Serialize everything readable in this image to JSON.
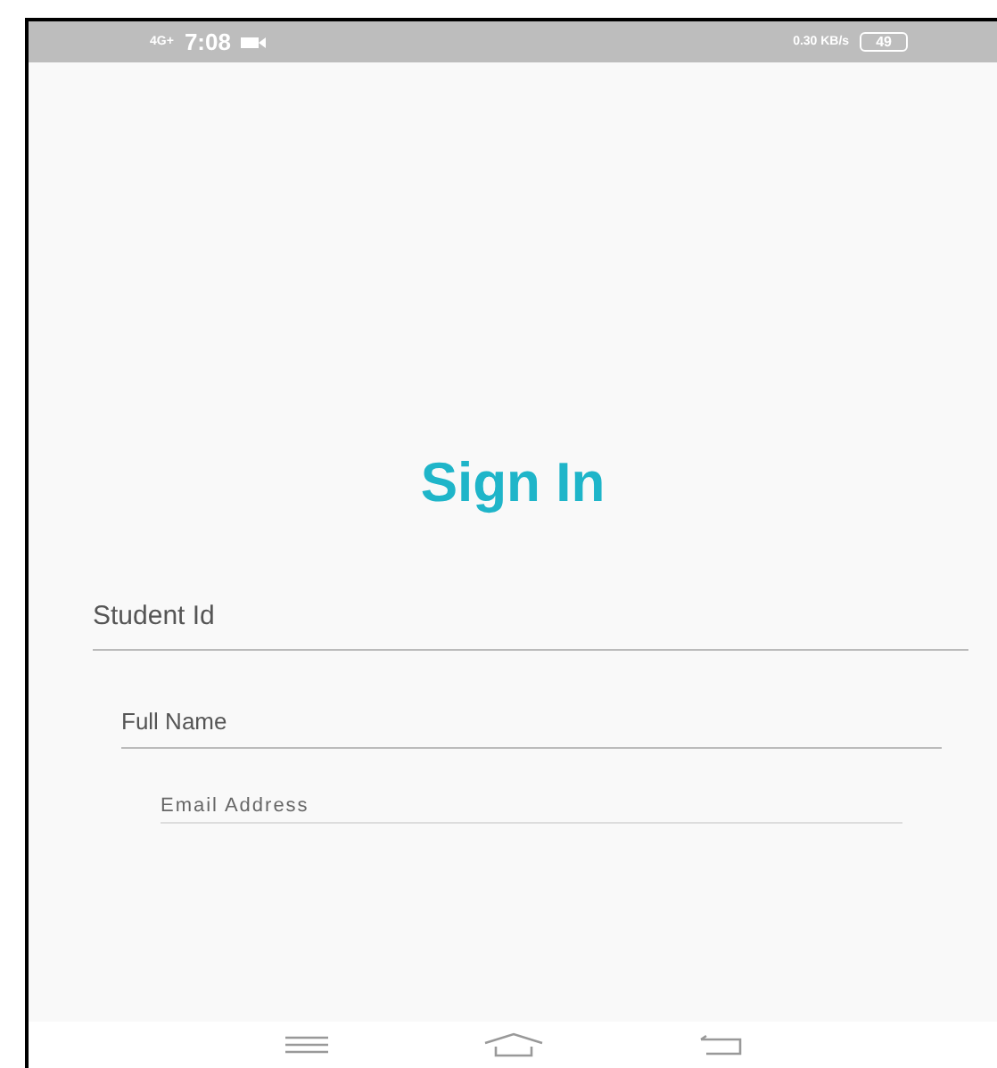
{
  "status_bar": {
    "network": "4G+",
    "time": "7:08",
    "speed": "0.30 KB/s",
    "battery": "49"
  },
  "title": "Sign In",
  "fields": [
    {
      "placeholder": "Student Id"
    },
    {
      "placeholder": "Full Name"
    },
    {
      "placeholder": "Email Address"
    }
  ]
}
